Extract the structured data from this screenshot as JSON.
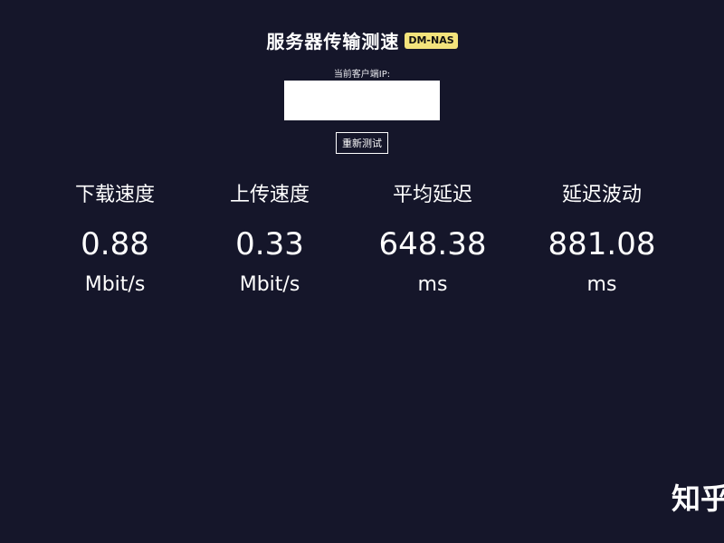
{
  "header": {
    "title": "服务器传输测速",
    "badge": "DM-NAS"
  },
  "client_ip": {
    "label": "当前客户端IP:",
    "value": ""
  },
  "retest_button": "重新测试",
  "metrics": [
    {
      "label": "下载速度",
      "value": "0.88",
      "unit": "Mbit/s"
    },
    {
      "label": "上传速度",
      "value": "0.33",
      "unit": "Mbit/s"
    },
    {
      "label": "平均延迟",
      "value": "648.38",
      "unit": "ms"
    },
    {
      "label": "延迟波动",
      "value": "881.08",
      "unit": "ms"
    }
  ],
  "watermark": "知乎"
}
